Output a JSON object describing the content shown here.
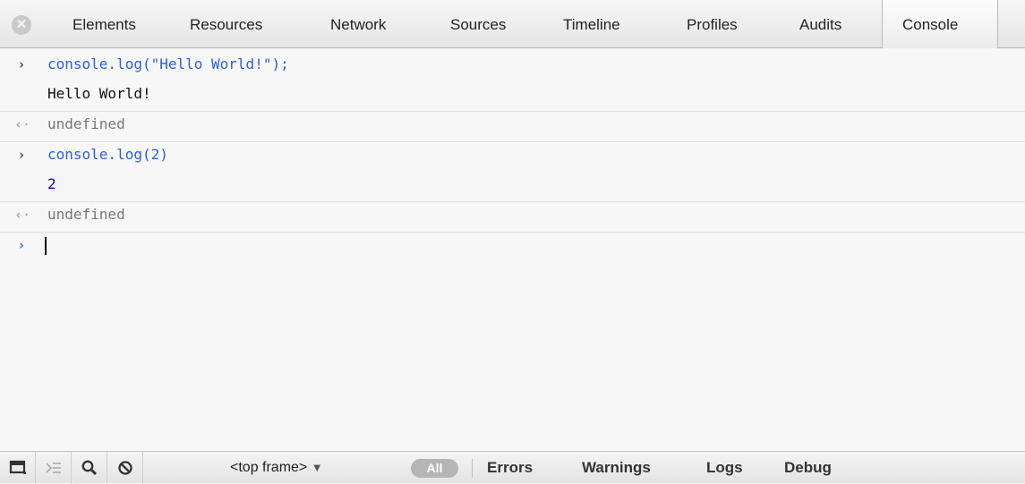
{
  "tabs": {
    "close_icon": "close-icon",
    "items": [
      {
        "label": "Elements"
      },
      {
        "label": "Resources"
      },
      {
        "label": "Network"
      },
      {
        "label": "Sources"
      },
      {
        "label": "Timeline"
      },
      {
        "label": "Profiles"
      },
      {
        "label": "Audits"
      },
      {
        "label": "Console"
      }
    ],
    "active": "Console"
  },
  "console": {
    "entries": [
      {
        "kind": "command",
        "glyph": "›",
        "text": "console.log(\"Hello World!\");"
      },
      {
        "kind": "log",
        "text": "Hello World!"
      },
      {
        "kind": "return",
        "glyph": "‹·",
        "text": "undefined"
      },
      {
        "kind": "command",
        "glyph": "›",
        "text": "console.log(2)"
      },
      {
        "kind": "number",
        "text": "2"
      },
      {
        "kind": "return",
        "glyph": "‹·",
        "text": "undefined"
      }
    ],
    "prompt_glyph": "›",
    "colors": {
      "command": "#2c5fd9",
      "number": "#1c00cf",
      "return": "#777777",
      "prompt": "#2c6fe0"
    }
  },
  "statusbar": {
    "frame_select": "<top frame>",
    "all_label": "All",
    "filters": [
      "Errors",
      "Warnings",
      "Logs",
      "Debug"
    ],
    "icons": [
      "dock-icon",
      "show-drawer-icon",
      "search-icon",
      "clear-icon"
    ]
  }
}
